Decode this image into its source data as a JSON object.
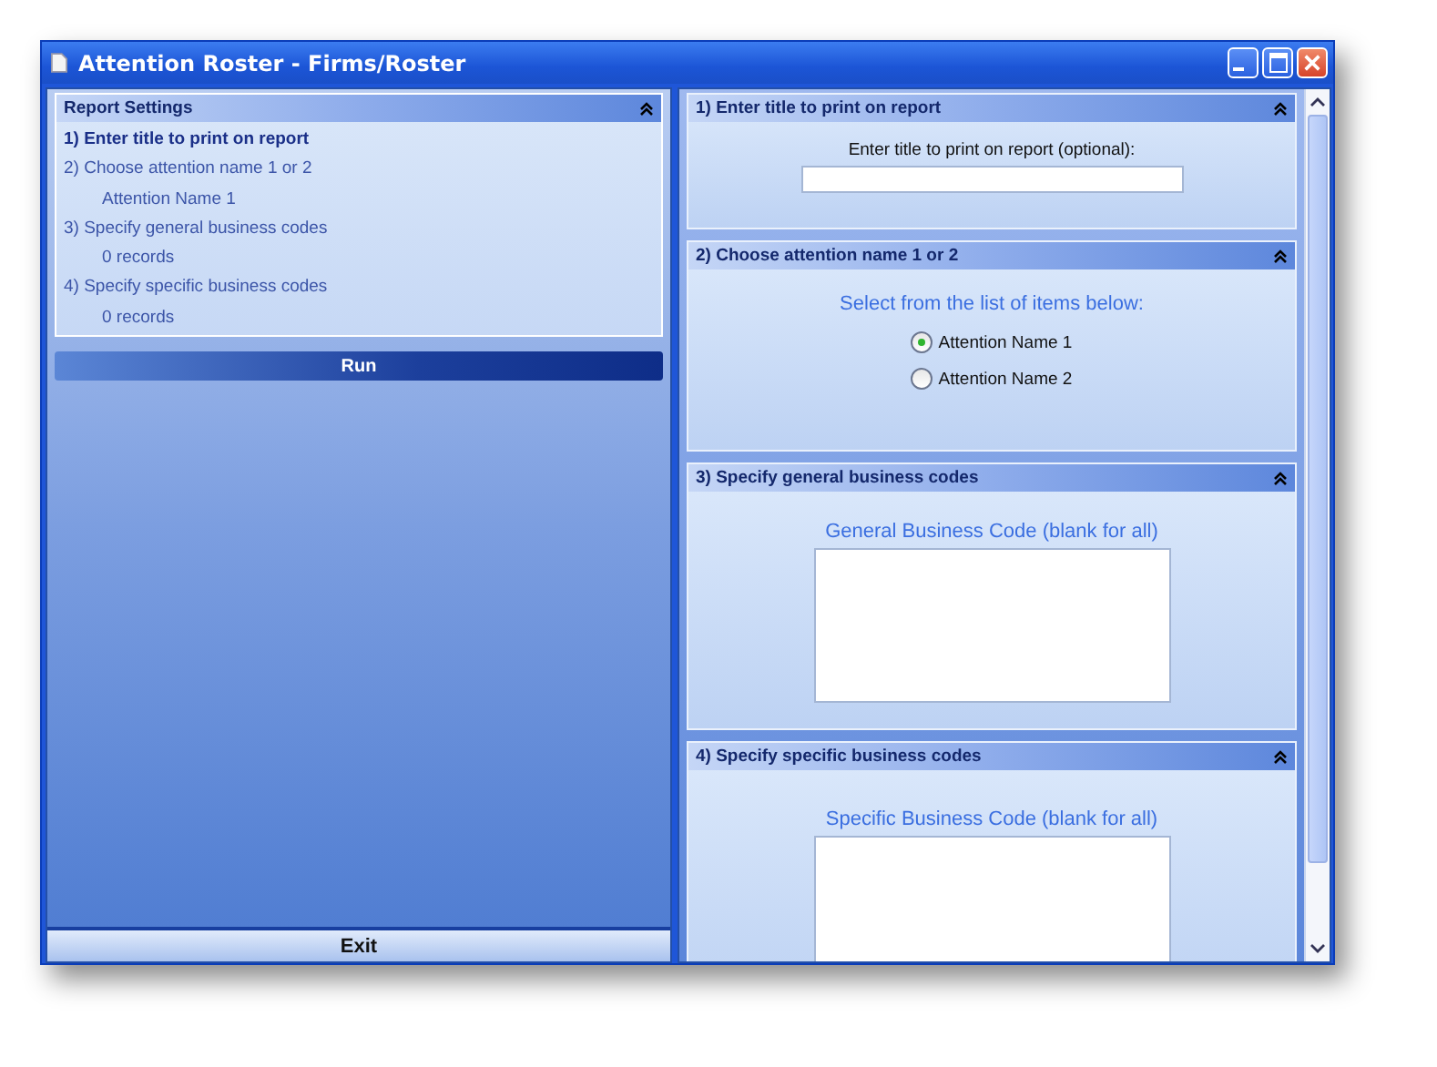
{
  "window": {
    "title": "Attention Roster - Firms/Roster"
  },
  "report_settings": {
    "title": "Report Settings",
    "steps": [
      {
        "label": "1)  Enter title to print on report",
        "selected": true
      },
      {
        "label": "2)  Choose attention name 1 or 2",
        "selected": false,
        "value": "Attention Name 1"
      },
      {
        "label": "3)  Specify general business codes",
        "selected": false,
        "value": "0 records"
      },
      {
        "label": "4)  Specify specific business codes",
        "selected": false,
        "value": "0 records"
      }
    ]
  },
  "run_button": "Run",
  "exit_button": "Exit",
  "sections": [
    {
      "kind": "text",
      "title": "1)  Enter title to print on report",
      "label": "Enter title to print on report (optional):"
    },
    {
      "kind": "radio",
      "title": "2)  Choose attention name 1 or 2",
      "label": "Select from the list of items below:",
      "options": [
        {
          "label": "Attention Name 1",
          "selected": true
        },
        {
          "label": "Attention Name 2",
          "selected": false
        }
      ]
    },
    {
      "kind": "list",
      "title": "3)  Specify general business codes",
      "label": "General Business Code (blank for all)"
    },
    {
      "kind": "list",
      "title": "4)  Specify specific business codes",
      "label": "Specific Business Code (blank for all)"
    }
  ]
}
